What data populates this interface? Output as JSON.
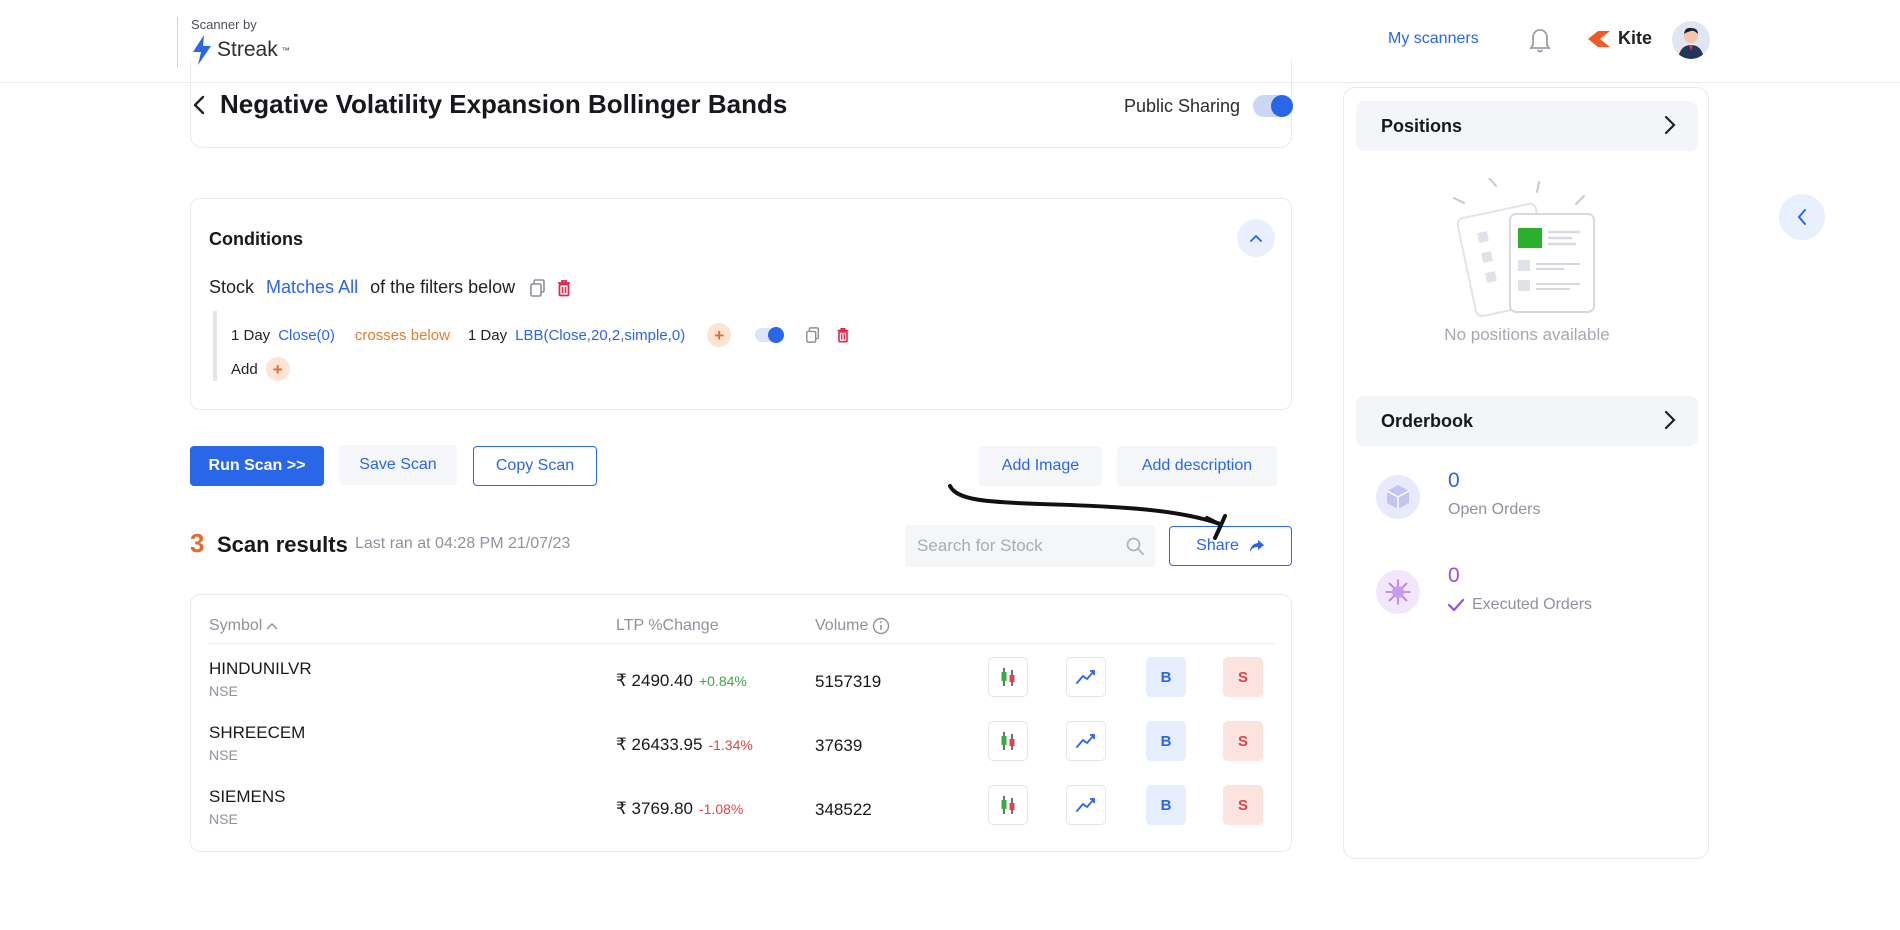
{
  "header": {
    "logo_small": "Scanner by",
    "logo_name": "Streak",
    "logo_tm": "™",
    "my_scanners": "My scanners",
    "kite_label": "Kite"
  },
  "scan": {
    "title": "Negative Volatility Expansion Bollinger Bands",
    "public_sharing_label": "Public Sharing",
    "public_sharing_on": true
  },
  "conditions": {
    "title": "Conditions",
    "stock_label": "Stock",
    "match_mode": "Matches All",
    "suffix": "of the filters below",
    "filter": {
      "tf1": "1 Day",
      "lhs": "Close(0)",
      "op": "crosses below",
      "tf2": "1 Day",
      "rhs": "LBB(Close,20,2,simple,0)",
      "plus": "+"
    },
    "add_label": "Add",
    "add_plus": "+"
  },
  "actions": {
    "run": "Run Scan >>",
    "save": "Save Scan",
    "copy": "Copy Scan",
    "add_image": "Add Image",
    "add_description": "Add description",
    "share": "Share"
  },
  "results": {
    "count": "3",
    "title": "Scan results",
    "last_ran": "Last ran at 04:28 PM 21/07/23",
    "search_placeholder": "Search for Stock",
    "columns": {
      "symbol": "Symbol",
      "ltp": "LTP %Change",
      "volume": "Volume"
    },
    "rows": [
      {
        "symbol": "HINDUNILVR",
        "exchange": "NSE",
        "ltp": "₹ 2490.40",
        "change": "+0.84%",
        "dir": "up",
        "volume": "5157319"
      },
      {
        "symbol": "SHREECEM",
        "exchange": "NSE",
        "ltp": "₹ 26433.95",
        "change": "-1.34%",
        "dir": "dn",
        "volume": "37639"
      },
      {
        "symbol": "SIEMENS",
        "exchange": "NSE",
        "ltp": "₹ 3769.80",
        "change": "-1.08%",
        "dir": "dn",
        "volume": "348522"
      }
    ],
    "buy_label": "B",
    "sell_label": "S"
  },
  "side": {
    "positions_label": "Positions",
    "no_positions": "No positions available",
    "orderbook_label": "Orderbook",
    "open_orders_count": "0",
    "open_orders_label": "Open Orders",
    "executed_orders_count": "0",
    "executed_orders_label": "Executed Orders"
  },
  "colors": {
    "accent": "#2a66e8",
    "orange": "#e8692a",
    "up": "#3aa845",
    "down": "#e04343",
    "executed": "#9b4be0"
  },
  "icons": [
    "streak-bolt-icon",
    "bell-icon",
    "kite-logo-icon",
    "avatar",
    "back-chevron-icon",
    "chevron-up-icon",
    "copy-icon",
    "trash-icon",
    "search-icon",
    "share-arrow-icon",
    "info-icon",
    "sort-asc-icon",
    "candlestick-icon",
    "line-chart-icon",
    "chevron-right-icon",
    "chevron-left-icon",
    "check-icon"
  ]
}
